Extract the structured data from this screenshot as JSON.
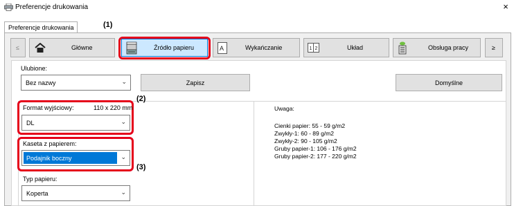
{
  "window": {
    "title": "Preferencje drukowania",
    "close_glyph": "×",
    "printer_icon": "printer-icon"
  },
  "tabstrip": {
    "tab_label": "Preferencje drukowania"
  },
  "nav": {
    "prev_glyph": "≤",
    "next_glyph": "≥",
    "items": [
      {
        "label": "Główne",
        "icon": "home-icon"
      },
      {
        "label": "Źródło papieru",
        "icon": "paper-tray-icon"
      },
      {
        "label": "Wykańczanie",
        "icon": "finishing-icon"
      },
      {
        "label": "Układ",
        "icon": "layout-icon"
      },
      {
        "label": "Obsługa pracy",
        "icon": "job-handling-icon"
      }
    ]
  },
  "favorites": {
    "label": "Ulubione:",
    "value": "Bez nazwy",
    "save_label": "Zapisz",
    "default_label": "Domyślne"
  },
  "output_size": {
    "label": "Format wyjściowy:",
    "size_readout": "110 x 220 mm",
    "value": "DL"
  },
  "paper_tray": {
    "label": "Kaseta z papierem:",
    "value": "Podajnik boczny"
  },
  "paper_type": {
    "label": "Typ papieru:",
    "value": "Koperta"
  },
  "notes": {
    "title": "Uwaga:",
    "lines": [
      "Cienki papier: 55 - 59 g/m2",
      "Zwykły-1: 60 - 89 g/m2",
      "Zwykły-2: 90 - 105 g/m2",
      "Gruby papier-1: 106 - 176 g/m2",
      "Gruby papier-2: 177 - 220 g/m2"
    ]
  },
  "callouts": {
    "c1": "(1)",
    "c2": "(2)",
    "c3": "(3)"
  },
  "colors": {
    "highlight": "#e5001a",
    "selected": "#0078d7",
    "nav_selected_bg": "#cce8ff",
    "panel_bg": "#f0f0f0"
  }
}
